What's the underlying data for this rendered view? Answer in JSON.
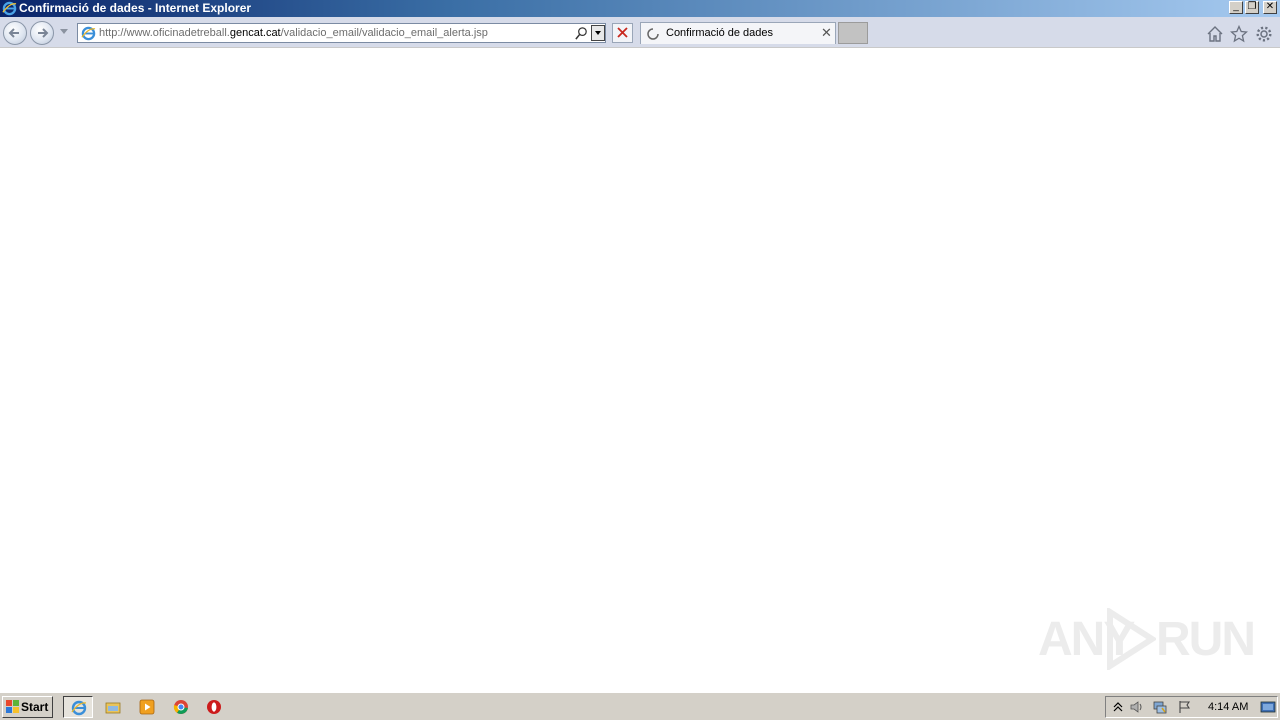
{
  "window": {
    "title": "Confirmació de dades - Internet Explorer"
  },
  "address_bar": {
    "url_prefix": "http://www.oficinadetreball.",
    "url_domain": "gencat.cat",
    "url_suffix": "/validacio_email/validacio_email_alerta.jsp"
  },
  "tabs": [
    {
      "label": "Confirmació de dades",
      "loading": true
    }
  ],
  "toolbar_icons": [
    "home-icon",
    "favorites-star-icon",
    "tools-gear-icon"
  ],
  "watermark": {
    "left": "ANY",
    "right": "RUN"
  },
  "taskbar": {
    "start_label": "Start",
    "apps": [
      "internet-explorer-icon",
      "file-explorer-icon",
      "media-player-icon",
      "chrome-icon",
      "opera-icon"
    ],
    "clock": "4:14 AM"
  },
  "colors": {
    "titlebar_start": "#0a246a",
    "titlebar_end": "#a6caf0",
    "taskbar": "#d4d0c8",
    "stop_red": "#c8281e"
  }
}
